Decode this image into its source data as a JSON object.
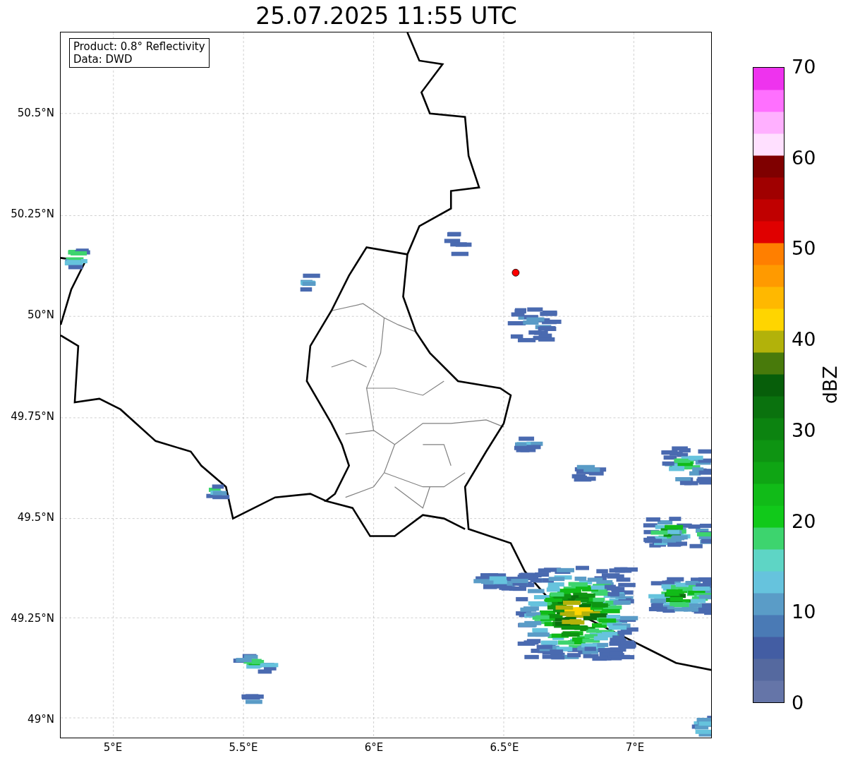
{
  "title": "25.07.2025 11:55 UTC",
  "info_box": [
    "Product: 0.8° Reflectivity",
    "Data: DWD"
  ],
  "lat_ticks": [
    "50.5°N",
    "50.25°N",
    "50°N",
    "49.75°N",
    "49.5°N",
    "49.25°N",
    "49°N"
  ],
  "lon_ticks": [
    "5°E",
    "5.5°E",
    "6°E",
    "6.5°E",
    "7°E"
  ],
  "colorbar": {
    "label": "dBZ",
    "ticks": [
      "70",
      "60",
      "50",
      "40",
      "30",
      "20",
      "10",
      "0"
    ]
  }
}
